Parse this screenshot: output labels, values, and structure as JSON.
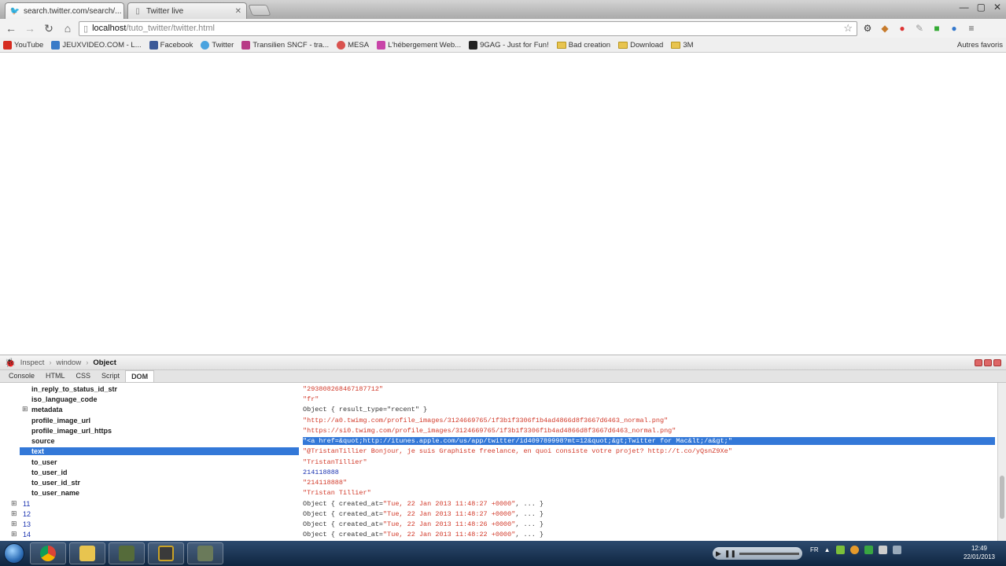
{
  "browser": {
    "tabs": [
      {
        "title": "search.twitter.com/search/...",
        "icon": "twitter-bird-icon"
      },
      {
        "title": "Twitter live",
        "icon": "page-icon"
      }
    ],
    "url_host": "localhost",
    "url_path": "/tuto_twitter/twitter.html",
    "bookmarks": [
      {
        "label": "YouTube",
        "icon": "youtube-icon",
        "color": "#d62b1f"
      },
      {
        "label": "JEUXVIDEO.COM - L...",
        "icon": "jeuxvideo-icon",
        "color": "#3a7bc8"
      },
      {
        "label": "Facebook",
        "icon": "facebook-icon",
        "color": "#3b5998"
      },
      {
        "label": "Twitter",
        "icon": "twitter-icon",
        "color": "#4aa3df"
      },
      {
        "label": "Transilien SNCF - tra...",
        "icon": "sncf-icon",
        "color": "#b83a86"
      },
      {
        "label": "MESA",
        "icon": "mesa-icon",
        "color": "#d9534f"
      },
      {
        "label": "L'hébergement Web...",
        "icon": "hosting-icon",
        "color": "#c844a8"
      },
      {
        "label": "9GAG - Just for Fun!",
        "icon": "9gag-icon",
        "color": "#222222"
      },
      {
        "label": "Bad creation",
        "icon": "folder-icon"
      },
      {
        "label": "Download",
        "icon": "folder-icon"
      },
      {
        "label": "3M",
        "icon": "folder-icon"
      }
    ],
    "other_bookmarks": "Autres favoris"
  },
  "devtools": {
    "breadcrumb": [
      "Inspect",
      "window",
      "Object"
    ],
    "tabs": [
      "Console",
      "HTML",
      "CSS",
      "Script",
      "DOM"
    ],
    "active_tab": "DOM",
    "rows": [
      {
        "key": "in_reply_to_status_id_str",
        "value": "\"293808268467187712\"",
        "type": "str"
      },
      {
        "key": "iso_language_code",
        "value": "\"fr\"",
        "type": "str"
      },
      {
        "key": "metadata",
        "value": "Object { result_type=\"recent\" }",
        "type": "obj",
        "expandable": true
      },
      {
        "key": "profile_image_url",
        "value": "\"http://a0.twimg.com/profile_images/3124669765/1f3b1f3306f1b4ad4866d8f3667d6463_normal.png\"",
        "type": "str"
      },
      {
        "key": "profile_image_url_https",
        "value": "\"https://si0.twimg.com/profile_images/3124669765/1f3b1f3306f1b4ad4866d8f3667d6463_normal.png\"",
        "type": "str"
      },
      {
        "key": "source",
        "value": "\"<a href=&quot;http://itunes.apple.com/us/app/twitter/id409789998?mt=12&quot;&gt;Twitter for Mac&lt;/a&gt;\"",
        "type": "str",
        "selected_value": true
      },
      {
        "key": "text",
        "value": "\"@TristanTillier Bonjour, je suis Graphiste freelance, en quoi consiste votre projet? http://t.co/yQsnZ9Xe\"",
        "type": "str",
        "selected_key": true
      },
      {
        "key": "to_user",
        "value": "\"TristanTillier\"",
        "type": "str"
      },
      {
        "key": "to_user_id",
        "value": "214118888",
        "type": "num"
      },
      {
        "key": "to_user_id_str",
        "value": "\"214118888\"",
        "type": "str"
      },
      {
        "key": "to_user_name",
        "value": "\"Tristan Tillier\"",
        "type": "str"
      }
    ],
    "children": [
      {
        "index": "11",
        "prefix": "Object { created_at=",
        "date": "\"Tue, 22 Jan 2013 11:48:27 +0000\"",
        "suffix": ", ... }"
      },
      {
        "index": "12",
        "prefix": "Object { created_at=",
        "date": "\"Tue, 22 Jan 2013 11:48:27 +0000\"",
        "suffix": ", ... }"
      },
      {
        "index": "13",
        "prefix": "Object { created_at=",
        "date": "\"Tue, 22 Jan 2013 11:48:26 +0000\"",
        "suffix": ", ... }"
      },
      {
        "index": "14",
        "prefix": "Object { created_at=",
        "date": "\"Tue, 22 Jan 2013 11:48:22 +0000\"",
        "suffix": ", ... }"
      }
    ]
  },
  "taskbar": {
    "language": "FR",
    "time": "12:49",
    "date": "22/01/2013"
  },
  "colors": {
    "selection": "#3378d8",
    "string": "#d23a2a",
    "number": "#1a32b0"
  }
}
